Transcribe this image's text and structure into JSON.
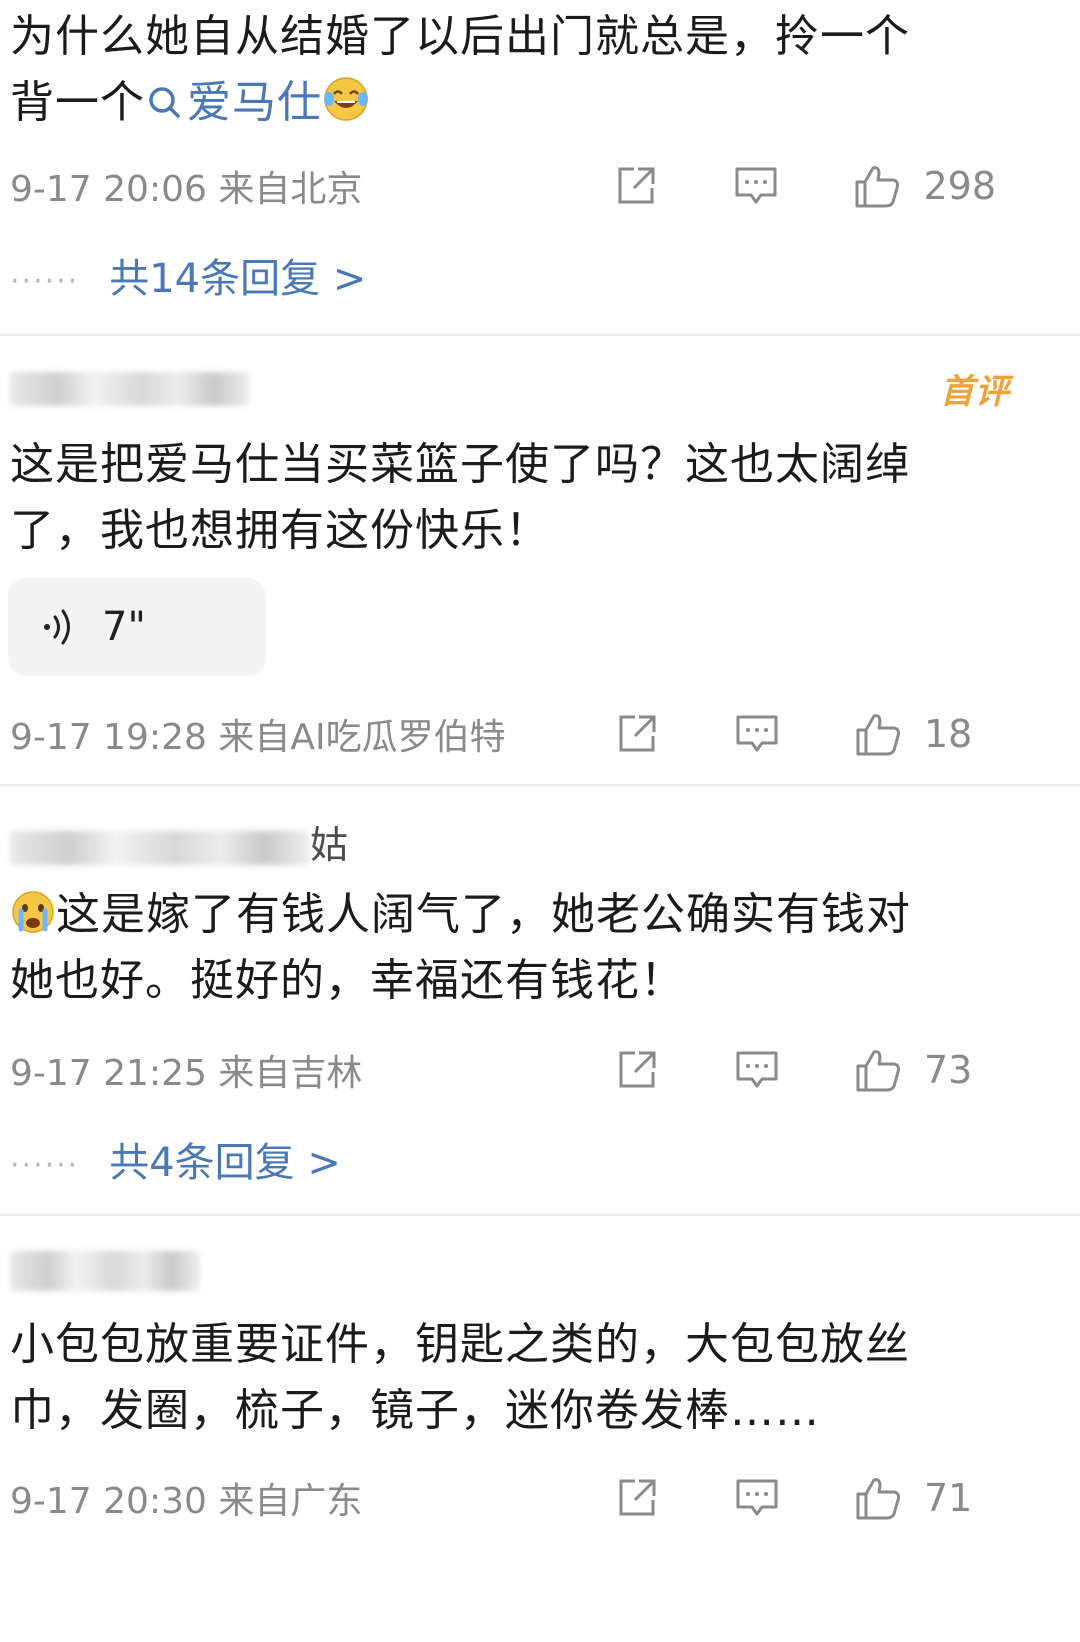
{
  "comments": [
    {
      "lines": [
        "为什么她自从结婚了以后出门就总是，拎一个",
        "背一个"
      ],
      "topic_link": "爱马仕",
      "time": "9-17 20:06 来自北京",
      "likes": "298",
      "replies": "共14条回复 >"
    },
    {
      "username_blurred": true,
      "badge": "首评",
      "lines": [
        "这是把爱马仕当买菜篮子使了吗？这也太阔绰",
        "了，我也想拥有这份快乐！"
      ],
      "voice_duration": "7\"",
      "time": "9-17 19:28 来自AI吃瓜罗伯特",
      "likes": "18"
    },
    {
      "username_suffix": "姑",
      "lines": [
        "这是嫁了有钱人阔气了，她老公确实有钱对",
        "她也好。挺好的，幸福还有钱花！"
      ],
      "time": "9-17 21:25 来自吉林",
      "likes": "73",
      "replies": "共4条回复 >"
    },
    {
      "lines": [
        "小包包放重要证件，钥匙之类的，大包包放丝",
        "巾，发圈，梳子，镜子，迷你卷发棒……"
      ],
      "time": "9-17 20:30 来自广东",
      "likes": "71"
    }
  ],
  "reply_dots": "······"
}
